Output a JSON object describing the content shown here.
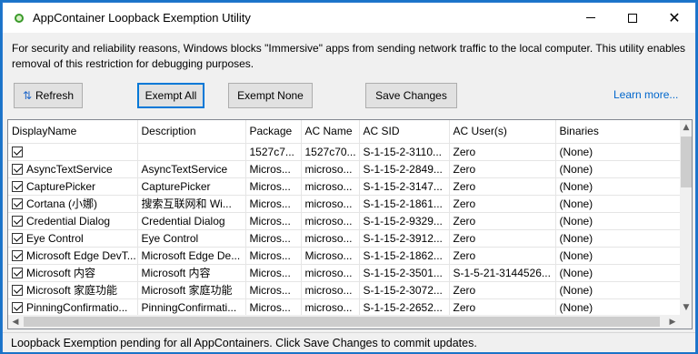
{
  "window": {
    "title": "AppContainer Loopback Exemption Utility",
    "controls": {
      "minimize": "minimize",
      "maximize": "maximize",
      "close": "✕"
    }
  },
  "info_text": "For security and reliability reasons, Windows blocks \"Immersive\" apps from sending network traffic to the local computer. This utility enables removal of this restriction for debugging purposes.",
  "toolbar": {
    "refresh_label": "Refresh",
    "exempt_all_label": "Exempt All",
    "exempt_none_label": "Exempt None",
    "save_label": "Save Changes",
    "learn_more": "Learn more..."
  },
  "grid": {
    "columns": [
      "DisplayName",
      "Description",
      "Package",
      "AC Name",
      "AC SID",
      "AC User(s)",
      "Binaries"
    ],
    "rows": [
      {
        "checked": true,
        "cells": [
          "",
          "",
          "1527c7...",
          "1527c70...",
          "S-1-15-2-3110...",
          "Zero",
          "(None)"
        ]
      },
      {
        "checked": true,
        "cells": [
          "AsyncTextService",
          "AsyncTextService",
          "Micros...",
          "microso...",
          "S-1-15-2-2849...",
          "Zero",
          "(None)"
        ]
      },
      {
        "checked": true,
        "cells": [
          "CapturePicker",
          "CapturePicker",
          "Micros...",
          "microso...",
          "S-1-15-2-3147...",
          "Zero",
          "(None)"
        ]
      },
      {
        "checked": true,
        "cells": [
          "Cortana (小娜)",
          "搜索互联网和 Wi...",
          "Micros...",
          "microso...",
          "S-1-15-2-1861...",
          "Zero",
          "(None)"
        ]
      },
      {
        "checked": true,
        "cells": [
          "Credential Dialog",
          "Credential Dialog",
          "Micros...",
          "microso...",
          "S-1-15-2-9329...",
          "Zero",
          "(None)"
        ]
      },
      {
        "checked": true,
        "cells": [
          "Eye Control",
          "Eye Control",
          "Micros...",
          "microso...",
          "S-1-15-2-3912...",
          "Zero",
          "(None)"
        ]
      },
      {
        "checked": true,
        "cells": [
          "Microsoft Edge DevT...",
          "Microsoft Edge De...",
          "Micros...",
          "Microso...",
          "S-1-15-2-1862...",
          "Zero",
          "(None)"
        ]
      },
      {
        "checked": true,
        "cells": [
          "Microsoft 内容",
          "Microsoft 内容",
          "Micros...",
          "microso...",
          "S-1-15-2-3501...",
          "S-1-5-21-3144526...",
          "(None)"
        ]
      },
      {
        "checked": true,
        "cells": [
          "Microsoft 家庭功能",
          "Microsoft 家庭功能",
          "Micros...",
          "microso...",
          "S-1-15-2-3072...",
          "Zero",
          "(None)"
        ]
      },
      {
        "checked": true,
        "cells": [
          "PinningConfirmatio...",
          "PinningConfirmati...",
          "Micros...",
          "microso...",
          "S-1-15-2-2652...",
          "Zero",
          "(None)"
        ]
      }
    ]
  },
  "scrollbars": {
    "up": "▲",
    "down": "▼",
    "left": "◀",
    "right": "▶"
  },
  "status_text": "Loopback Exemption pending for all AppContainers. Click Save Changes to commit updates."
}
